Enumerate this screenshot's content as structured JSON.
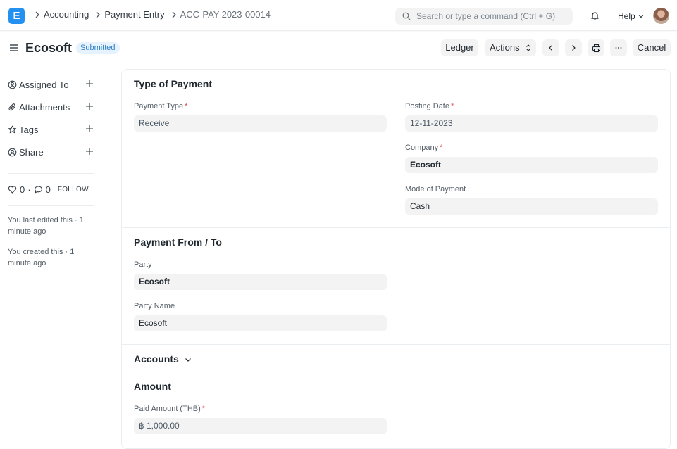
{
  "app": {
    "logo_letter": "E",
    "brand_color": "#2490ef"
  },
  "breadcrumb": {
    "items": [
      "Accounting",
      "Payment Entry",
      "ACC-PAY-2023-00014"
    ]
  },
  "search": {
    "placeholder": "Search or type a command (Ctrl + G)"
  },
  "navbar": {
    "help_label": "Help",
    "icons": [
      "bell-icon",
      "avatar"
    ]
  },
  "page": {
    "title": "Ecosoft",
    "status": "Submitted",
    "status_color": "#2b7ec3",
    "buttons": {
      "ledger": "Ledger",
      "actions": "Actions",
      "cancel": "Cancel"
    }
  },
  "sidebar": {
    "items": [
      {
        "label": "Assigned To",
        "icon": "assign-icon"
      },
      {
        "label": "Attachments",
        "icon": "paperclip-icon"
      },
      {
        "label": "Tags",
        "icon": "tag-icon"
      },
      {
        "label": "Share",
        "icon": "share-icon"
      }
    ],
    "likes": "0",
    "comments": "0",
    "follow": "FOLLOW",
    "activity": [
      "You last edited this · 1 minute ago",
      "You created this · 1 minute ago"
    ]
  },
  "form": {
    "type_of_payment": {
      "title": "Type of Payment",
      "payment_type_label": "Payment Type",
      "payment_type_value": "Receive",
      "posting_date_label": "Posting Date",
      "posting_date_value": "12-11-2023",
      "company_label": "Company",
      "company_value": "Ecosoft",
      "mode_label": "Mode of Payment",
      "mode_value": "Cash",
      "required_mark": "*"
    },
    "payment_from_to": {
      "title": "Payment From / To",
      "party_label": "Party",
      "party_value": "Ecosoft",
      "party_name_label": "Party Name",
      "party_name_value": "Ecosoft"
    },
    "accounts": {
      "title": "Accounts"
    },
    "amount": {
      "title": "Amount",
      "paid_amount_label": "Paid Amount (THB)",
      "paid_amount_value": "฿ 1,000.00"
    }
  }
}
